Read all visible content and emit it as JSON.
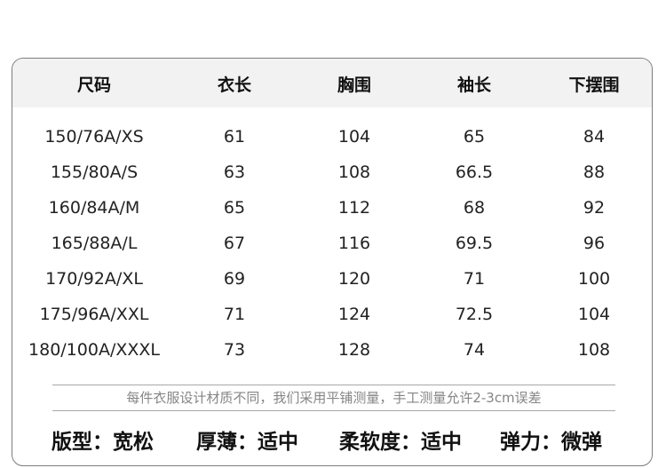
{
  "table": {
    "headers": [
      "尺码",
      "衣长",
      "胸围",
      "袖长",
      "下摆围"
    ],
    "rows": [
      [
        "150/76A/XS",
        "61",
        "104",
        "65",
        "84"
      ],
      [
        "155/80A/S",
        "63",
        "108",
        "66.5",
        "88"
      ],
      [
        "160/84A/M",
        "65",
        "112",
        "68",
        "92"
      ],
      [
        "165/88A/L",
        "67",
        "116",
        "69.5",
        "96"
      ],
      [
        "170/92A/XL",
        "69",
        "120",
        "71",
        "100"
      ],
      [
        "175/96A/XXL",
        "71",
        "124",
        "72.5",
        "104"
      ],
      [
        "180/100A/XXXL",
        "73",
        "128",
        "74",
        "108"
      ]
    ]
  },
  "note": "每件衣服设计材质不同，我们采用平铺测量，手工测量允许2-3cm误差",
  "specs": [
    "版型：宽松",
    "厚薄：适中",
    "柔软度：适中",
    "弹力：微弹"
  ]
}
